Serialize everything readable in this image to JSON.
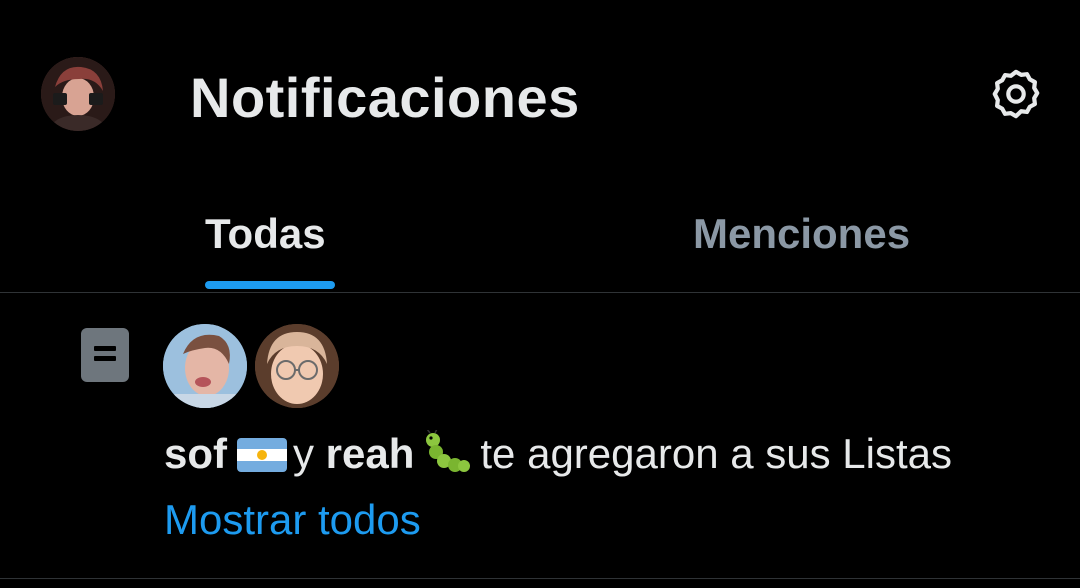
{
  "header": {
    "title": "Notificaciones",
    "settings_icon": "gear-icon"
  },
  "tabs": [
    {
      "label": "Todas",
      "active": true
    },
    {
      "label": "Menciones",
      "active": false
    }
  ],
  "notification": {
    "icon": "list-icon",
    "user1": "sof",
    "user1_emoji": "argentina-flag-icon",
    "connector": "y",
    "user2": "reah",
    "user2_emoji": "caterpillar-icon",
    "message": "te agregaron a sus Listas",
    "show_all": "Mostrar todos"
  },
  "colors": {
    "background": "#000000",
    "text_primary": "#e7e9ea",
    "text_secondary": "#8b98a5",
    "accent": "#1d9bf0",
    "divider": "#2f3336"
  }
}
